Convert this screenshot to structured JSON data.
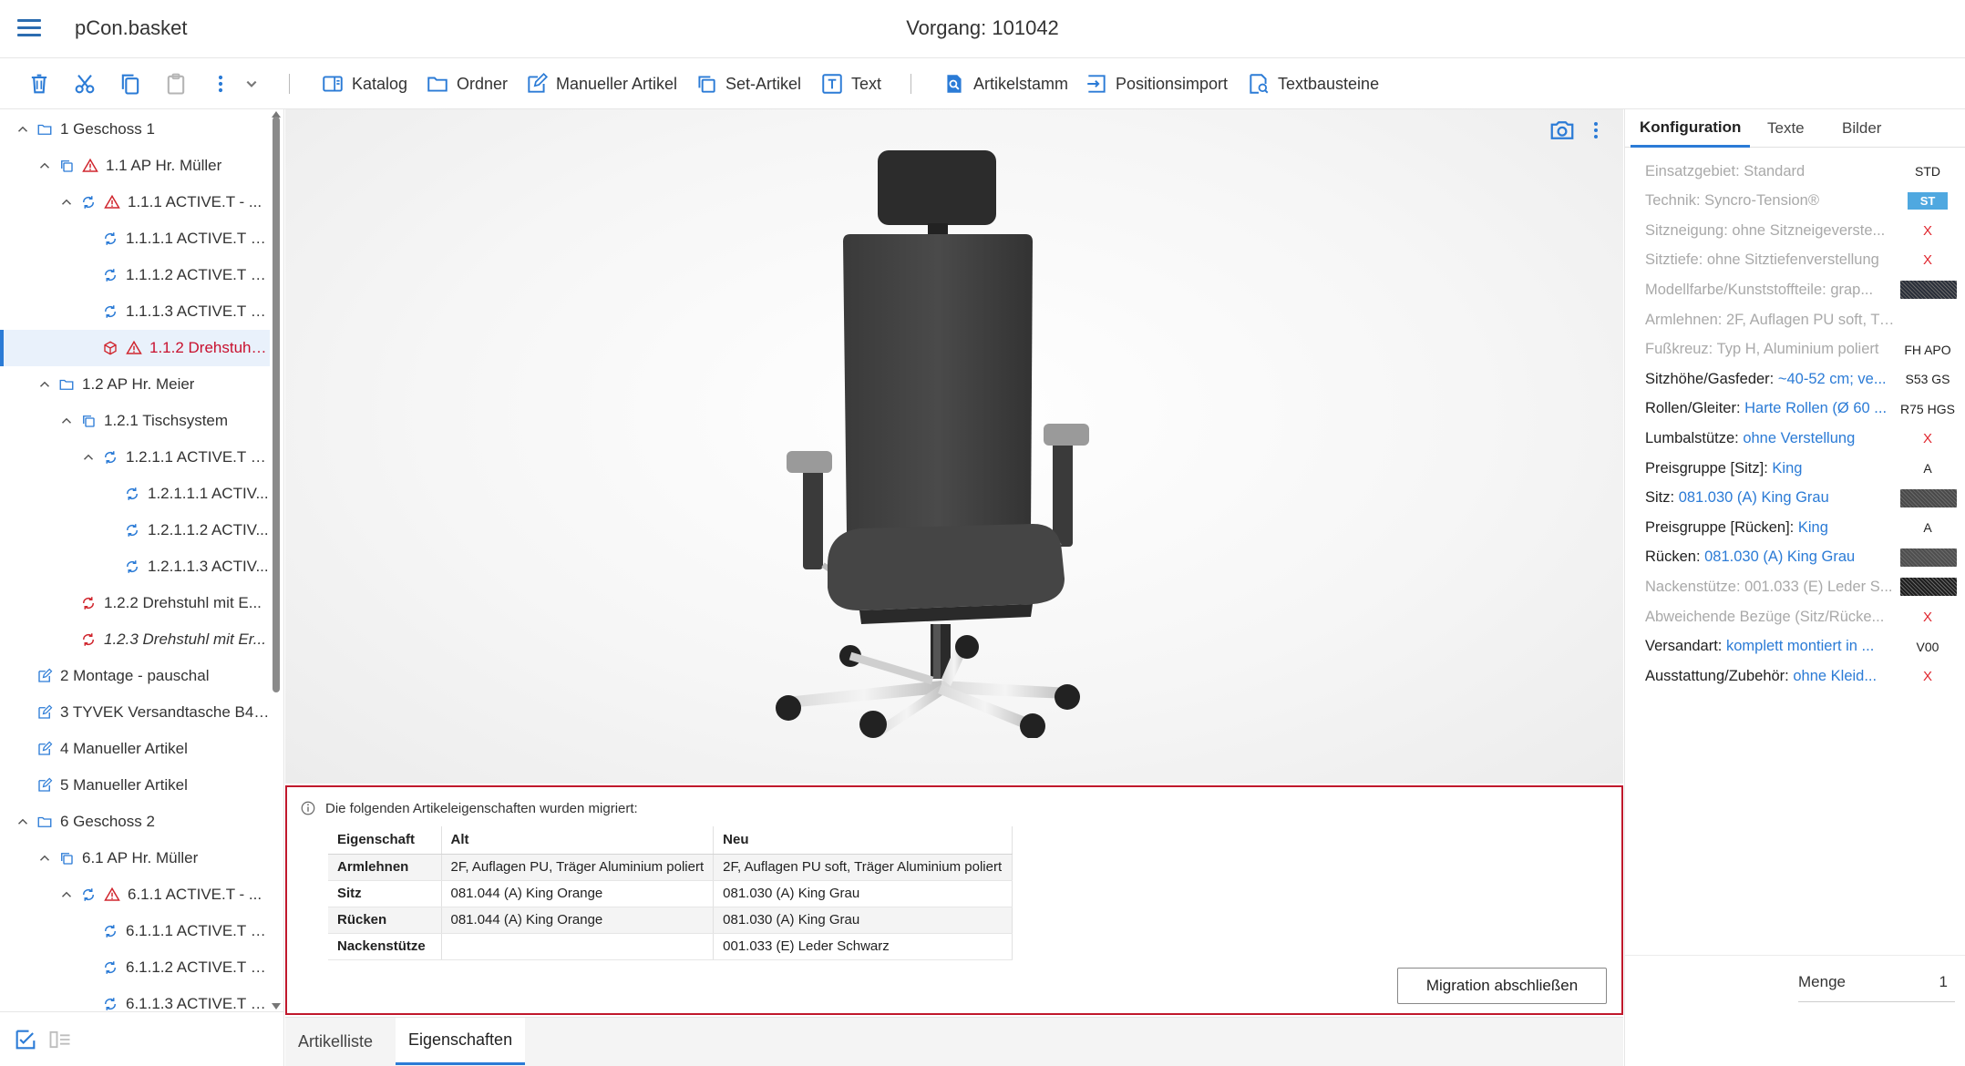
{
  "header": {
    "app_title": "pCon.basket",
    "doc_title": "Vorgang: 101042"
  },
  "toolbar": {
    "buttons": [
      {
        "label": "Katalog",
        "icon": "catalog-icon"
      },
      {
        "label": "Ordner",
        "icon": "folder-icon"
      },
      {
        "label": "Manueller Artikel",
        "icon": "edit-icon"
      },
      {
        "label": "Set-Artikel",
        "icon": "set-icon"
      },
      {
        "label": "Text",
        "icon": "text-icon"
      },
      {
        "label": "Artikelstamm",
        "icon": "search-doc-icon"
      },
      {
        "label": "Positionsimport",
        "icon": "import-icon"
      },
      {
        "label": "Textbausteine",
        "icon": "text-blocks-icon"
      }
    ]
  },
  "tree": [
    {
      "label": "1 Geschoss 1"
    },
    {
      "label": "1.1 AP Hr. Müller"
    },
    {
      "label": "1.1.1 ACTIVE.T - ..."
    },
    {
      "label": "1.1.1.1 ACTIVE.T - ..."
    },
    {
      "label": "1.1.1.2 ACTIVE.T - ..."
    },
    {
      "label": "1.1.1.3 ACTIVE.T - ..."
    },
    {
      "label": "1.1.2 Drehstuhl mi..."
    },
    {
      "label": "1.2 AP Hr. Meier"
    },
    {
      "label": "1.2.1 Tischsystem"
    },
    {
      "label": "1.2.1.1 ACTIVE.T - ..."
    },
    {
      "label": "1.2.1.1.1 ACTIV..."
    },
    {
      "label": "1.2.1.1.2 ACTIV..."
    },
    {
      "label": "1.2.1.1.3 ACTIV..."
    },
    {
      "label": "1.2.2 Drehstuhl mit E..."
    },
    {
      "label": "1.2.3 Drehstuhl mit Er..."
    },
    {
      "label": "2 Montage - pauschal"
    },
    {
      "label": "3 TYVEK Versandtasche B4 ..."
    },
    {
      "label": "4 Manueller Artikel"
    },
    {
      "label": "5 Manueller Artikel"
    },
    {
      "label": "6 Geschoss 2"
    },
    {
      "label": "6.1 AP Hr. Müller"
    },
    {
      "label": "6.1.1 ACTIVE.T - ..."
    },
    {
      "label": "6.1.1.1 ACTIVE.T - ..."
    },
    {
      "label": "6.1.1.2 ACTIVE.T - ..."
    },
    {
      "label": "6.1.1.3 ACTIVE.T - ..."
    }
  ],
  "migration": {
    "info": "Die folgenden Artikeleigenschaften wurden migriert:",
    "headers": [
      "Eigenschaft",
      "Alt",
      "Neu"
    ],
    "rows": [
      [
        "Armlehnen",
        "2F, Auflagen PU, Träger Aluminium poliert",
        "2F, Auflagen PU soft, Träger Aluminium poliert"
      ],
      [
        "Sitz",
        "081.044 (A) King Orange",
        "081.030 (A) King Grau"
      ],
      [
        "Rücken",
        "081.044 (A) King Orange",
        "081.030 (A) King Grau"
      ],
      [
        "Nackenstütze",
        "",
        "001.033 (E) Leder Schwarz"
      ]
    ],
    "button_label": "Migration abschließen"
  },
  "bottom_tabs": [
    {
      "label": "Artikelliste"
    },
    {
      "label": "Eigenschaften"
    }
  ],
  "right": {
    "tabs": [
      {
        "label": "Konfiguration"
      },
      {
        "label": "Texte"
      },
      {
        "label": "Bilder"
      }
    ],
    "props": [
      {
        "label": "Einsatzgebiet: ",
        "value": "Standard",
        "code": "STD"
      },
      {
        "label": "Technik: ",
        "value": "Syncro-Tension®",
        "code": "ST"
      },
      {
        "label": "Sitzneigung: ",
        "value": "ohne Sitzneigeverste...",
        "code": "X"
      },
      {
        "label": "Sitztiefe: ",
        "value": "ohne Sitztiefenverstellung",
        "code": "X"
      },
      {
        "label": "Modellfarbe/Kunststoffteile: ",
        "value": "grap..."
      },
      {
        "label": "Armlehnen: ",
        "value": "2F, Auflagen PU soft, Träger Al..."
      },
      {
        "label": "Fußkreuz: ",
        "value": "Typ H, Aluminium poliert",
        "code": "FH APO"
      },
      {
        "label": "Sitzhöhe/Gasfeder: ",
        "value": "~40-52 cm; ve...",
        "code": "S53 GS"
      },
      {
        "label": "Rollen/Gleiter: ",
        "value": "Harte Rollen (Ø 60 ...",
        "code": "R75 HGS"
      },
      {
        "label": "Lumbalstütze: ",
        "value": "ohne Verstellung",
        "code": "X"
      },
      {
        "label": "Preisgruppe [Sitz]: ",
        "value": "King",
        "code": "A"
      },
      {
        "label": "Sitz: ",
        "value": "081.030 (A) King Grau"
      },
      {
        "label": "Preisgruppe [Rücken]: ",
        "value": "King",
        "code": "A"
      },
      {
        "label": "Rücken: ",
        "value": "081.030 (A) King Grau"
      },
      {
        "label": "Nackenstütze: ",
        "value": "001.033 (E) Leder S..."
      },
      {
        "label": "Abweichende Bezüge (Sitz/Rücke...",
        "value": "",
        "code": "X"
      },
      {
        "label": "Versandart: ",
        "value": "komplett montiert in ...",
        "code": "V00"
      },
      {
        "label": "Ausstattung/Zubehör: ",
        "value": "ohne Kleid...",
        "code": "X"
      }
    ],
    "menge_label": "Menge",
    "menge_value": "1"
  },
  "colors": {
    "accent": "#2b7bd6",
    "error": "#c8102e",
    "migration_border": "#c0182c",
    "badge": "#4fa8e0"
  }
}
